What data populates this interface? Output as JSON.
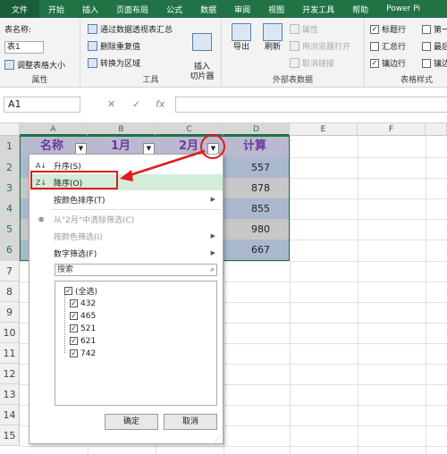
{
  "tabs": [
    {
      "label": "文件"
    },
    {
      "label": "开始"
    },
    {
      "label": "插入"
    },
    {
      "label": "页面布局"
    },
    {
      "label": "公式"
    },
    {
      "label": "数据"
    },
    {
      "label": "审阅"
    },
    {
      "label": "视图"
    },
    {
      "label": "开发工具"
    },
    {
      "label": "帮助"
    },
    {
      "label": "Power Pi"
    }
  ],
  "ribbon": {
    "properties": {
      "name_label": "表名称:",
      "name_value": "表1",
      "resize": "调整表格大小",
      "group": "属性"
    },
    "tools": {
      "pivot": "通过数据透视表汇总",
      "dedupe": "删除重复值",
      "convert": "转换为区域",
      "slicer": "插入\n切片器",
      "group": "工具"
    },
    "external": {
      "export": "导出",
      "refresh": "刷新",
      "properties": "属性",
      "browser": "用浏览器打开",
      "unlink": "取消链接",
      "group": "外部表数据"
    },
    "style_options": {
      "header_row": "标题行",
      "total_row": "汇总行",
      "banded_rows": "镶边行",
      "first_col": "第一列",
      "last_col": "最后列",
      "banded_cols": "镶边列",
      "group": "表格样式"
    }
  },
  "formula_bar": {
    "cell_ref": "A1",
    "cancel": "✕",
    "enter": "✓",
    "fx": "fx"
  },
  "columns": [
    "A",
    "B",
    "C",
    "D",
    "E",
    "F"
  ],
  "rows": [
    "1",
    "2",
    "3",
    "4",
    "5",
    "6",
    "7",
    "8",
    "9",
    "10",
    "11",
    "12",
    "13",
    "14",
    "15"
  ],
  "table": {
    "headers": [
      "名称",
      "1月",
      "2月",
      "计算"
    ],
    "d_values": [
      "557",
      "878",
      "855",
      "980",
      "667"
    ]
  },
  "filter_menu": {
    "sort_asc": "升序(S)",
    "sort_desc": "降序(O)",
    "sort_color": "按颜色排序(T)",
    "clear_filter": "从\"2月\"中清除筛选(C)",
    "filter_color": "按颜色筛选(I)",
    "number_filter": "数字筛选(F)",
    "search_placeholder": "搜索",
    "items": [
      "(全选)",
      "432",
      "465",
      "521",
      "621",
      "742"
    ],
    "ok": "确定",
    "cancel": "取消"
  },
  "colors": {
    "excel_green": "#217346",
    "highlight_red": "#e01b1b"
  }
}
